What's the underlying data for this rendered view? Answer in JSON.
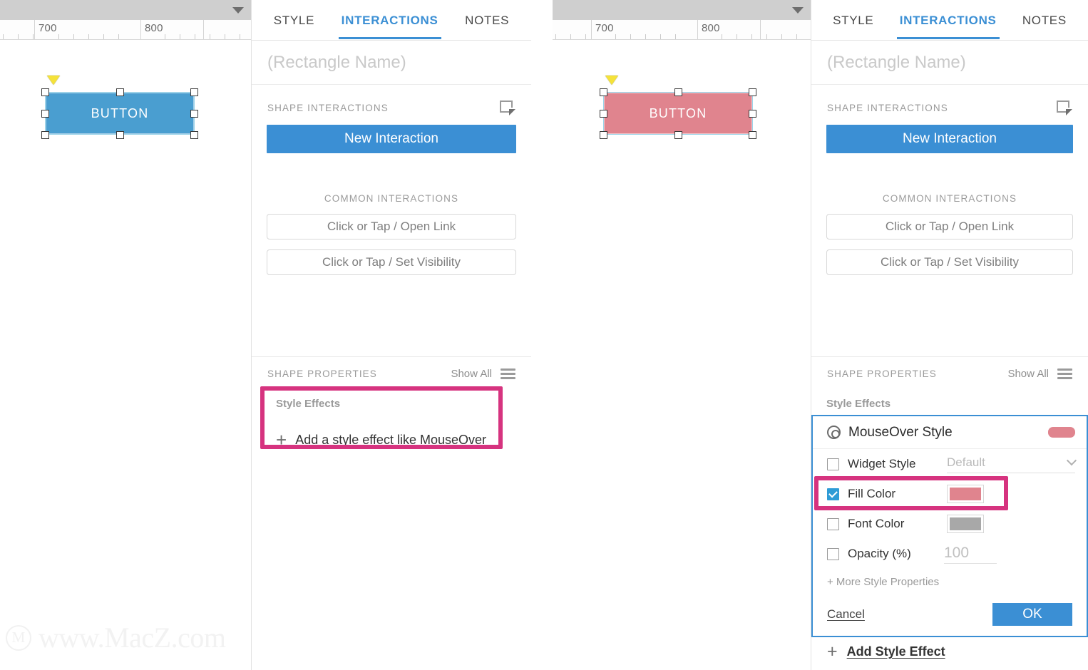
{
  "canvases": [
    {
      "id": "canvas-default",
      "ruler": {
        "labels": [
          "700",
          "800"
        ]
      },
      "shape": {
        "label": "BUTTON",
        "fill": "#4a9ed0",
        "text_color": "#ffffff"
      }
    },
    {
      "id": "canvas-mouseover",
      "ruler": {
        "labels": [
          "700",
          "800"
        ]
      },
      "shape": {
        "label": "BUTTON",
        "fill": "#e0848e",
        "text_color": "#ffffff"
      }
    }
  ],
  "watermark": {
    "logo": "M",
    "text": "www.MacZ.com"
  },
  "panel_left": {
    "tabs": [
      {
        "label": "STYLE",
        "active": false
      },
      {
        "label": "INTERACTIONS",
        "active": true
      },
      {
        "label": "NOTES",
        "active": false
      }
    ],
    "name_placeholder": "(Rectangle Name)",
    "shape_interactions": {
      "title": "SHAPE INTERACTIONS",
      "new_interaction_label": "New Interaction"
    },
    "common_interactions": {
      "title": "COMMON INTERACTIONS",
      "items": [
        "Click or Tap / Open Link",
        "Click or Tap / Set Visibility"
      ]
    },
    "shape_properties": {
      "title": "SHAPE PROPERTIES",
      "show_all_label": "Show All",
      "style_effects_label": "Style Effects",
      "add_style_effect_link": "Add a style effect like MouseOver"
    }
  },
  "panel_right": {
    "tabs": [
      {
        "label": "STYLE",
        "active": false
      },
      {
        "label": "INTERACTIONS",
        "active": true
      },
      {
        "label": "NOTES",
        "active": false
      }
    ],
    "name_placeholder": "(Rectangle Name)",
    "shape_interactions": {
      "title": "SHAPE INTERACTIONS",
      "new_interaction_label": "New Interaction"
    },
    "common_interactions": {
      "title": "COMMON INTERACTIONS",
      "items": [
        "Click or Tap / Open Link",
        "Click or Tap / Set Visibility"
      ]
    },
    "shape_properties": {
      "title": "SHAPE PROPERTIES",
      "show_all_label": "Show All",
      "style_effects_label": "Style Effects"
    },
    "mouseover_dialog": {
      "title": "MouseOver Style",
      "swatch_color": "#e0848e",
      "rows": [
        {
          "label": "Widget Style",
          "checked": false,
          "control": "dropdown",
          "value": "Default"
        },
        {
          "label": "Fill Color",
          "checked": true,
          "control": "color",
          "value": "#e0848e"
        },
        {
          "label": "Font Color",
          "checked": false,
          "control": "color",
          "value": "#a8a8a8"
        },
        {
          "label": "Opacity (%)",
          "checked": false,
          "control": "number",
          "value": "100"
        }
      ],
      "more_properties_label": "+ More Style Properties",
      "cancel_label": "Cancel",
      "ok_label": "OK"
    },
    "add_style_effect_link": "Add Style Effect"
  },
  "highlight_color": "#d6337f",
  "accent_color": "#3b8fd4"
}
